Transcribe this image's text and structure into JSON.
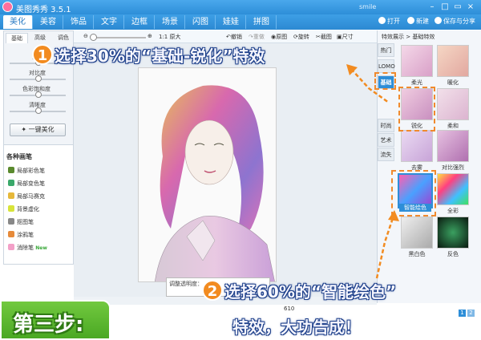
{
  "window": {
    "title": "美图秀秀 3.5.1",
    "user": "smile"
  },
  "nav": {
    "tabs": [
      "美化",
      "美容",
      "饰品",
      "文字",
      "边框",
      "场景",
      "闪图",
      "娃娃",
      "拼图"
    ],
    "actions": [
      "打开",
      "新建",
      "保存与分享"
    ]
  },
  "toolbar": {
    "zoom_label": "1:1 原大",
    "undo": "撤销",
    "redo": "重做",
    "reset": "原图",
    "rotate": "旋转",
    "crop": "截图",
    "size": "尺寸"
  },
  "left": {
    "subtabs": [
      "基础",
      "高级",
      "调色"
    ],
    "sliders": [
      "亮度",
      "对比度",
      "色彩饱和度",
      "清晰度"
    ],
    "slider_values": [
      0.5,
      0.5,
      0.5,
      0.5
    ],
    "beautify_button": "一键美化",
    "brush_title": "各种画笔",
    "brushes": [
      "局部彩色笔",
      "局部变色笔",
      "局部马赛克",
      "背景虚化",
      "抠图笔",
      "涂鸦笔",
      "消除笔"
    ],
    "new_badge": "New"
  },
  "canvas": {
    "opacity_label": "调整透明度：",
    "dims": "610"
  },
  "right": {
    "breadcrumb": "特效展示 > 基础特效",
    "sidetabs": [
      "热门",
      "LOMO",
      "基础",
      "时尚",
      "艺术",
      "流失"
    ],
    "effects": [
      {
        "label": "柔光"
      },
      {
        "label": "暖化"
      },
      {
        "label": "锐化"
      },
      {
        "label": "柔和"
      },
      {
        "label": "去雾"
      },
      {
        "label": "对比强烈"
      },
      {
        "label": "智能绘色"
      },
      {
        "label": "全彩"
      },
      {
        "label": "黑白色"
      },
      {
        "label": "反色"
      }
    ],
    "pages": [
      "1",
      "2"
    ]
  },
  "callouts": {
    "step1_num": "1",
    "step1_text": "选择30%的“基础-锐化”特效",
    "step2_num": "2",
    "step2_line1": "选择60%的“智能绘色”",
    "step2_line2": "特效，大功告成！",
    "step3": "第三步:"
  },
  "colors": {
    "accent": "#2d8ed8",
    "callout_orange": "#f28b20",
    "step_green": "#5bb52c"
  }
}
